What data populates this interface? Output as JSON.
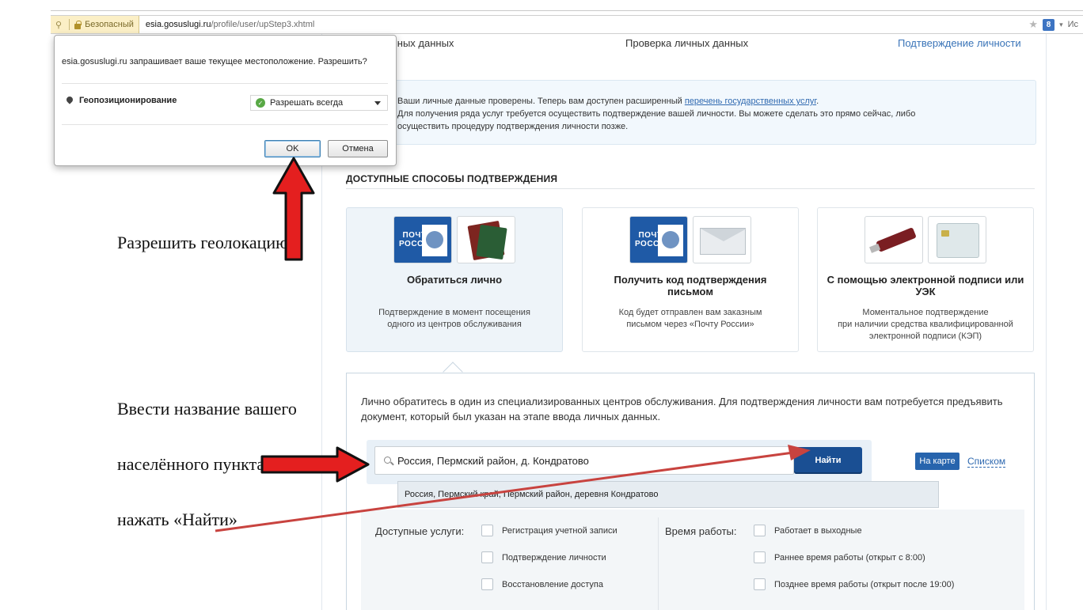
{
  "browser": {
    "security_label": "Безопасный",
    "url_domain": "esia.gosuslugi.ru",
    "url_path": "/profile/user/upStep3.xhtml",
    "search_hint": "Ис"
  },
  "steps": {
    "step1": "чных данных",
    "step2": "Проверка личных данных",
    "step3": "Подтверждение личности"
  },
  "info": {
    "line1_before": "Ваши личные данные проверены. Теперь вам доступен расширенный ",
    "line1_link": "перечень государственных услуг",
    "line1_after": ".",
    "line2": "Для получения ряда услуг требуется осуществить подтверждение вашей личности. Вы можете сделать это прямо сейчас, либо",
    "line3": "осуществить процедуру подтверждения личности позже."
  },
  "section_title": "ДОСТУПНЫЕ СПОСОБЫ ПОДТВЕРЖДЕНИЯ",
  "methods": [
    {
      "name": "Обратиться лично",
      "desc1": "Подтверждение в момент посещения",
      "desc2": "одного из центров обслуживания",
      "desc3": ""
    },
    {
      "name": "Получить код подтверждения письмом",
      "desc1": "Код будет отправлен вам заказным",
      "desc2": "письмом через «Почту России»",
      "desc3": ""
    },
    {
      "name": "С помощью электронной подписи или УЭК",
      "desc1": "Моментальное подтверждение",
      "desc2": "при наличии средства квалифицированной",
      "desc3": "электронной подписи (КЭП)"
    }
  ],
  "logo": {
    "line1": "ПОЧТА",
    "line2": "РОССИИ"
  },
  "panel": {
    "text": "Лично обратитесь в один из специализированных центров обслуживания. Для подтверждения личности вам потребуется предъявить документ, который был указан на этапе ввода личных данных.",
    "search_value": "Россия, Пермский район, д. Кондратово",
    "find_label": "Найти",
    "map_label": "На карте",
    "list_label": "Списком",
    "suggestion": "Россия, Пермский край, Пермский район, деревня Кондратово"
  },
  "filters": {
    "services_label": "Доступные услуги:",
    "services": [
      "Регистрация учетной записи",
      "Подтверждение личности",
      "Восстановление доступа"
    ],
    "hours_label": "Время работы:",
    "hours": [
      "Работает в выходные",
      "Раннее время работы (открыт с 8:00)",
      "Позднее время работы (открыт после 19:00)"
    ]
  },
  "popup": {
    "question": "esia.gosuslugi.ru запрашивает ваше текущее местоположение. Разрешить?",
    "permission_label": "Геопозиционирование",
    "select_value": "Разрешать всегда",
    "ok_label": "OK",
    "cancel_label": "Отмена"
  },
  "annotations": {
    "geo_note": "Разрешить геолокацию",
    "search_note_1": "Ввести название вашего",
    "search_note_2": "населённого пункта,",
    "search_note_3": "нажать  «Найти»"
  },
  "colors": {
    "brand_blue": "#1a4f93",
    "link_blue": "#2f69b0",
    "arrow_red": "#e41f1f",
    "line_red": "#c8433f"
  },
  "icons": [
    "location-pin-icon",
    "lock-icon",
    "star-icon",
    "google-plus-icon",
    "search-icon",
    "geo-pin-icon",
    "checkmark-icon",
    "chevron-down-icon"
  ]
}
